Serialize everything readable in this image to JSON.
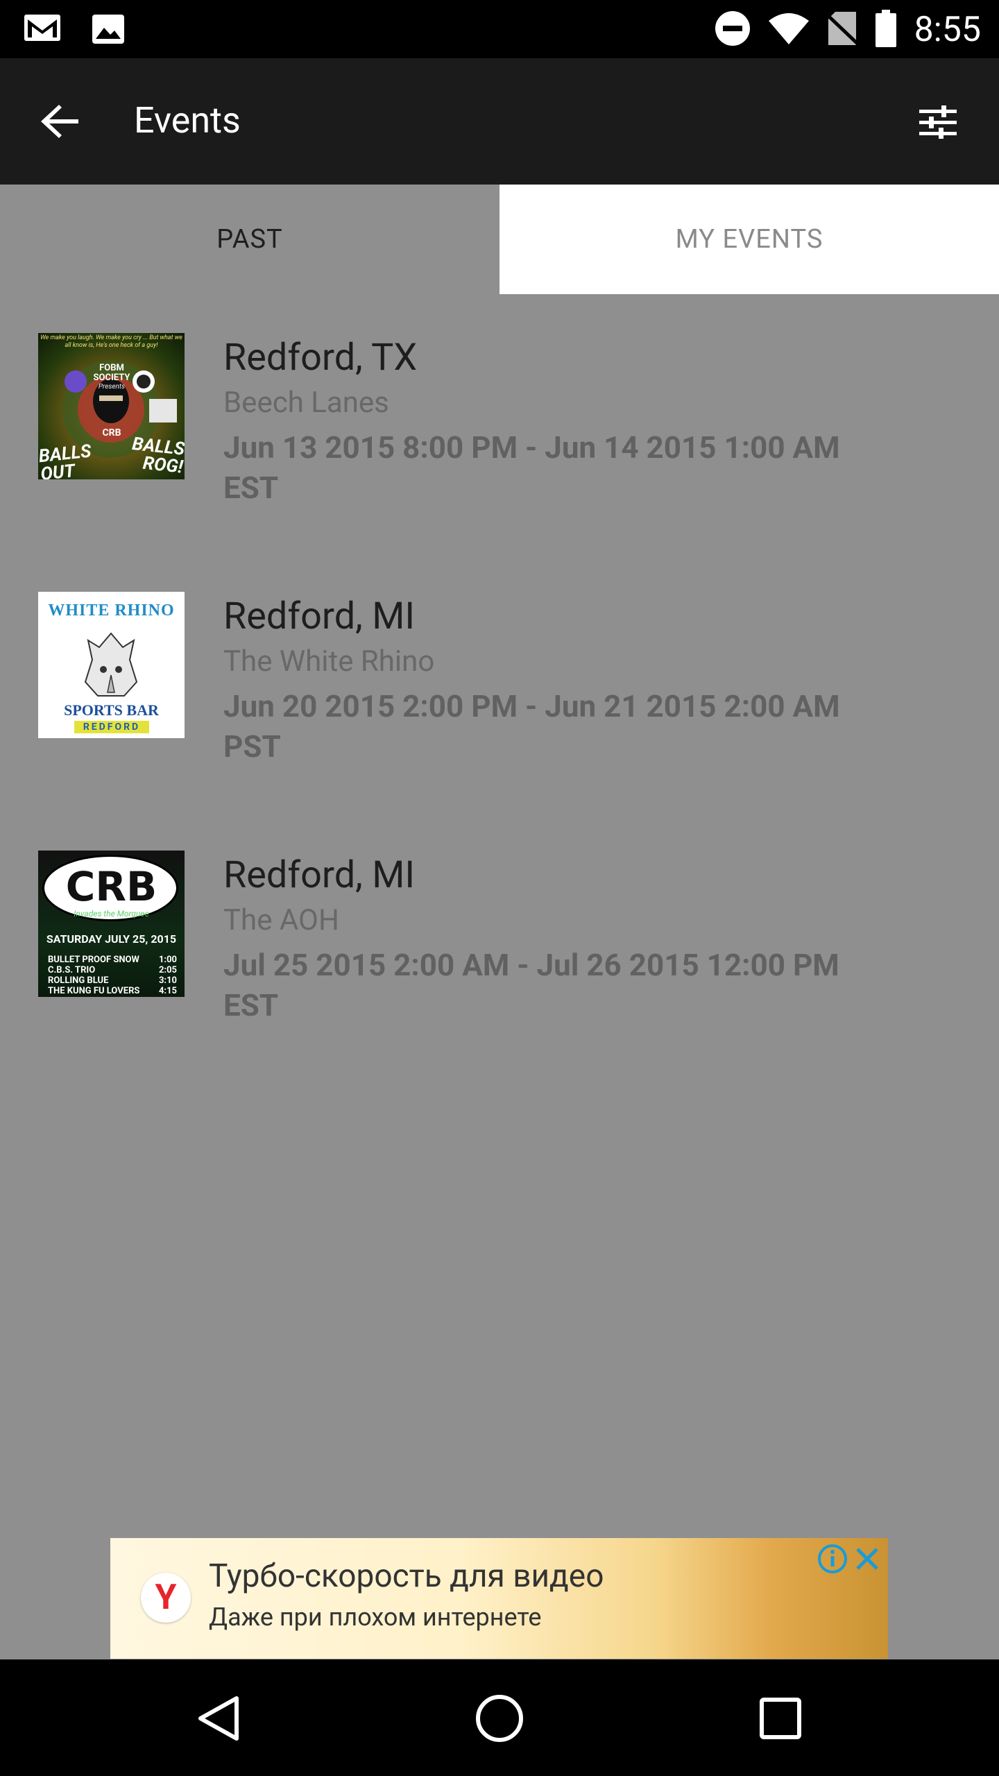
{
  "status_bar": {
    "time": "8:55",
    "icons_left": [
      "gmail-icon",
      "image-icon"
    ],
    "icons_right": [
      "do-not-disturb-icon",
      "wifi-icon",
      "no-sim-icon",
      "battery-icon"
    ]
  },
  "app_bar": {
    "title": "Events",
    "back_icon": "arrow-back-icon",
    "filter_icon": "tune-icon"
  },
  "tabs": [
    {
      "label": "PAST",
      "selected": true
    },
    {
      "label": "MY EVENTS",
      "selected": false
    }
  ],
  "events": [
    {
      "city": "Redford, TX",
      "venue": "Beech Lanes",
      "date_line1": "Jun 13 2015 8:00 PM - Jun 14 2015 1:00 AM",
      "date_line2": "EST",
      "thumb": {
        "top_text": "We make you laugh. We make you cry ... But what we all know is, He's one heck of a guy!",
        "badge": "FOBM SOCIETY",
        "badge_sub": "Presents",
        "center": "CRB",
        "left": "BALLS OUT",
        "right": "BALLS ROG!"
      }
    },
    {
      "city": "Redford, MI",
      "venue": "The White Rhino",
      "date_line1": "Jun 20 2015 2:00 PM - Jun 21 2015 2:00 AM",
      "date_line2": "PST",
      "thumb": {
        "title": "WHITE RHINO",
        "bar": "SPORTS BAR",
        "place": "REDFORD"
      }
    },
    {
      "city": "Redford, MI",
      "venue": "The AOH",
      "date_line1": "Jul 25 2015 2:00 AM - Jul 26 2015 12:00 PM",
      "date_line2": "EST",
      "thumb": {
        "logo": "CRB",
        "tagline": "Invades the Morquee",
        "date": "SATURDAY JULY 25, 2015",
        "lineup": [
          {
            "band": "BULLET PROOF SNOW",
            "time": "1:00"
          },
          {
            "band": "C.B.S. TRIO",
            "time": "2:05"
          },
          {
            "band": "ROLLING BLUE",
            "time": "3:10"
          },
          {
            "band": "THE KUNG FU LOVERS",
            "time": "4:15"
          }
        ]
      }
    }
  ],
  "ad": {
    "headline": "Турбо-скорость для видео",
    "subline": "Даже при плохом интернете",
    "logo_letter": "Y",
    "info_icon": "info-icon",
    "close_icon": "close-icon"
  },
  "nav_bar": {
    "back_icon": "nav-back-icon",
    "home_icon": "nav-home-icon",
    "recents_icon": "nav-recents-icon"
  },
  "colors": {
    "background": "#8f8f8f",
    "app_bar": "#1b1b1b",
    "tab_selected_bg": "#8f8f8f",
    "tab_unselected_bg": "#ffffff"
  }
}
